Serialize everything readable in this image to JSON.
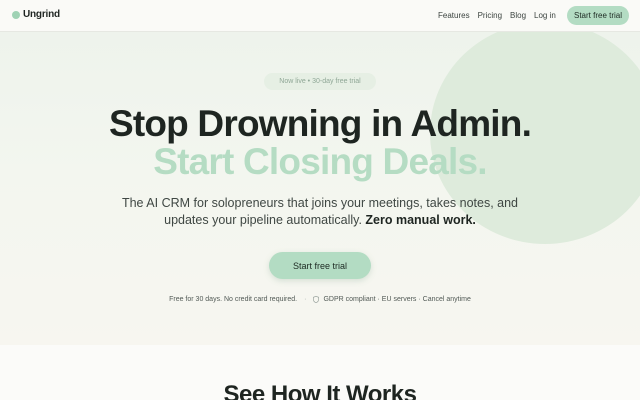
{
  "nav": {
    "brand": "Ungrind",
    "links": [
      "Features",
      "Pricing",
      "Blog"
    ],
    "login": "Log in",
    "cta": "Start free trial"
  },
  "hero": {
    "badge": "Now live • 30-day free trial",
    "headline_1": "Stop Drowning in Admin.",
    "headline_2": "Start Closing Deals.",
    "subtext_main": "The AI CRM for solopreneurs that joins your meetings, takes notes, and updates your pipeline automatically.",
    "subtext_bold": "Zero manual work.",
    "cta": "Start free trial",
    "fineprint_1": "Free for 30 days. No credit card required.",
    "separator": "·",
    "fineprint_2": "GDPR compliant · EU servers · Cancel anytime"
  },
  "next_section": {
    "title": "See How It Works"
  },
  "colors": {
    "accent": "#b3dcc3",
    "accent_text": "#b5dcc3",
    "circle": "#deebdc"
  },
  "icons": {
    "brand": "brand-dot-icon",
    "fineprint": "shield-icon"
  }
}
